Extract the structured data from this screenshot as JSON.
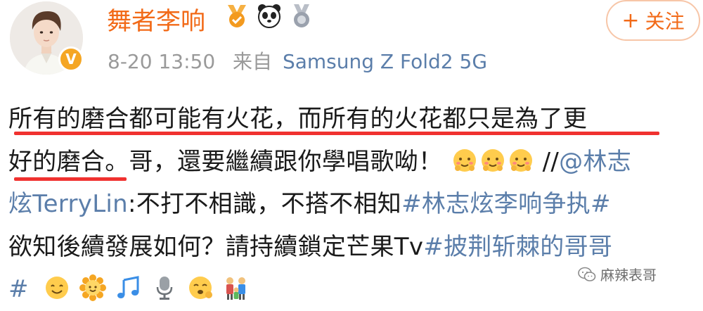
{
  "user": {
    "name": "舞者李响",
    "verified_icon": "V",
    "badge_icons": [
      "gold-medal-badge-icon",
      "panda-icon",
      "silver-medal-badge-icon"
    ]
  },
  "meta": {
    "date_time": "8-20 13:50",
    "source_prefix": "来自",
    "device": "Samsung Z Fold2 5G"
  },
  "follow_button": {
    "plus": "+",
    "label": "关注"
  },
  "post": {
    "line1": "所有的磨合都可能有火花，而所有的火花都只是為了更",
    "line2_a": "好的磨合。哥，還要繼續跟你學唱歌呦！",
    "line2_b": "//",
    "line2_mention": "@林志",
    "line3_mention": "炫TerryLin",
    "line3_text": ":不打不相識，不搭不相知",
    "line3_tag": "#林志炫李响争执#",
    "line4_text": "欲知後續發展如何？請持續鎖定芒果Tv",
    "line4_tag": "#披荆斩棘的哥哥",
    "line5_tag": "#"
  },
  "emoji_names": {
    "line2": [
      "smiling-blush-icon",
      "smiling-blush-icon",
      "smiling-blush-icon"
    ],
    "line5": [
      "smile-icon",
      "sunflower-face-icon",
      "music-notes-icon",
      "microphone-icon",
      "hehe-face-icon",
      "family-icon"
    ]
  },
  "colors": {
    "username": "#f26a18",
    "link": "#5b7eaa",
    "underline": "#f0312f",
    "meta": "#9a9a9a"
  },
  "watermark": "麻辣表哥"
}
